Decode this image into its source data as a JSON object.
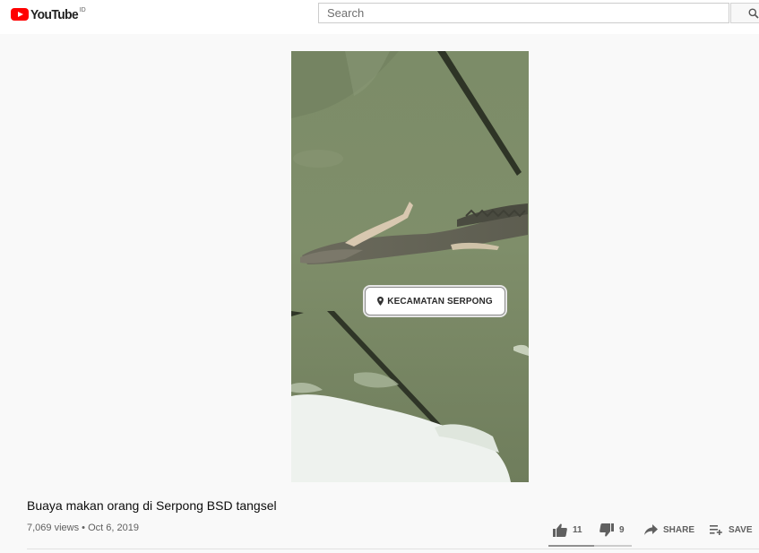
{
  "header": {
    "logo_text": "YouTube",
    "country_code": "ID",
    "search_placeholder": "Search"
  },
  "video": {
    "overlay_location": "KECAMATAN SERPONG",
    "title": "Buaya makan orang di Serpong BSD tangsel",
    "views": "7,069 views",
    "date": "Oct 6, 2019",
    "meta_separator": " • "
  },
  "actions": {
    "like_count": "11",
    "dislike_count": "9",
    "share_label": "SHARE",
    "save_label": "SAVE",
    "like_ratio": 0.55
  },
  "colors": {
    "brand_red": "#ff0000",
    "water_green": "#7f8d6a",
    "text_secondary": "#606060"
  },
  "icons": [
    "youtube-logo-icon",
    "search-icon",
    "location-pin-icon",
    "thumbs-up-icon",
    "thumbs-down-icon",
    "share-icon",
    "add-to-playlist-icon"
  ]
}
